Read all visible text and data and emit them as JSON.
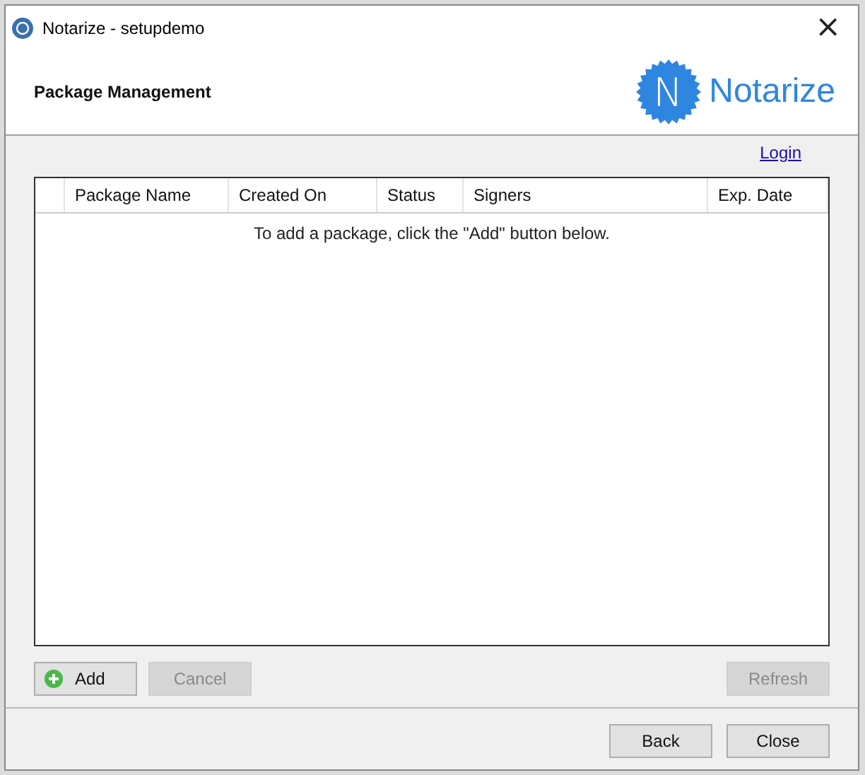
{
  "window": {
    "title": "Notarize - setupdemo",
    "close": "×"
  },
  "header": {
    "title": "Package Management",
    "logo": {
      "mark": "N",
      "text": "Notarize"
    }
  },
  "login_link": "Login",
  "table": {
    "columns": [
      "",
      "Package Name",
      "Created On",
      "Status",
      "Signers",
      "Exp. Date"
    ],
    "empty_message": "To add a package, click the \"Add\" button below."
  },
  "actions": [
    {
      "label": "Add",
      "kind": "add",
      "disabled": false
    },
    {
      "label": "Cancel",
      "disabled": true
    },
    {
      "label": "Refresh",
      "disabled": true
    }
  ],
  "footer_buttons": [
    {
      "label": "Back"
    },
    {
      "label": "Close"
    }
  ]
}
